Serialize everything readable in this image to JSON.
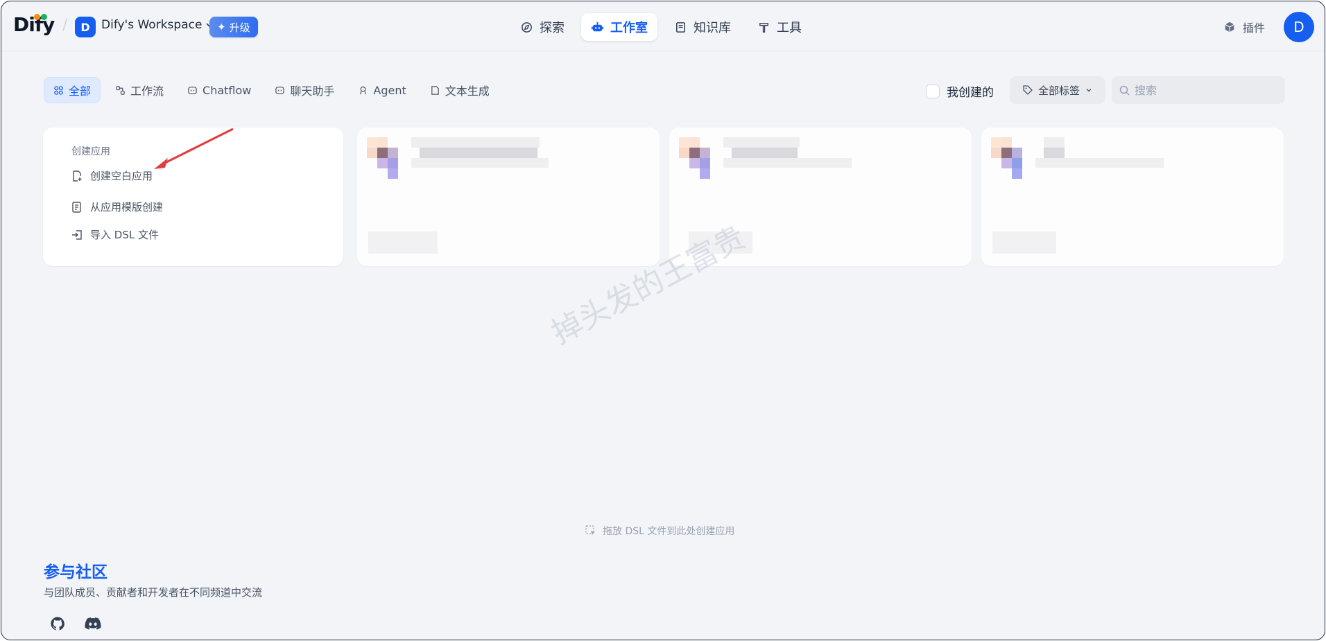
{
  "header": {
    "logo_text": "Dify",
    "workspace_initial": "D",
    "workspace_name": "Dify's Workspace",
    "upgrade_label": "升级",
    "nav": [
      {
        "label": "探索",
        "icon": "compass-icon"
      },
      {
        "label": "工作室",
        "icon": "robot-icon",
        "active": true
      },
      {
        "label": "知识库",
        "icon": "book-icon"
      },
      {
        "label": "工具",
        "icon": "hammer-icon"
      }
    ],
    "plugins_label": "插件",
    "avatar_initial": "D"
  },
  "filters": {
    "tabs": [
      {
        "label": "全部",
        "active": true
      },
      {
        "label": "工作流"
      },
      {
        "label": "Chatflow"
      },
      {
        "label": "聊天助手"
      },
      {
        "label": "Agent"
      },
      {
        "label": "文本生成"
      }
    ],
    "mine_label": "我创建的",
    "tags_label": "全部标签",
    "search_placeholder": "搜索"
  },
  "create": {
    "title": "创建应用",
    "items": [
      {
        "label": "创建空白应用"
      },
      {
        "label": "从应用模版创建"
      },
      {
        "label": "导入 DSL 文件"
      }
    ]
  },
  "drop_hint": "拖放 DSL 文件到此处创建应用",
  "watermark": "掉头发的王富贵",
  "community": {
    "title": "参与社区",
    "description": "与团队成员、贡献者和开发者在不同频道中交流"
  },
  "colors": {
    "accent": "#155eef",
    "background": "#f2f4f7"
  }
}
